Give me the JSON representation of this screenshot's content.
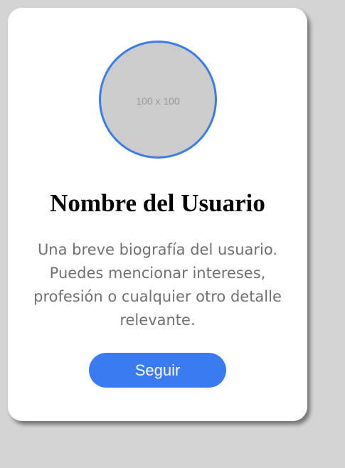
{
  "profile": {
    "avatar_placeholder": "100 x 100",
    "name": "Nombre del Usuario",
    "bio": "Una breve biografía del usuario. Puedes mencionar intereses, profesión o cualquier otro detalle relevante.",
    "follow_label": "Seguir"
  },
  "colors": {
    "page_background": "#d4d4d4",
    "card_background": "#ffffff",
    "accent": "#3b7bf2",
    "avatar_border": "#3b7ce8",
    "bio_text": "#707070"
  }
}
